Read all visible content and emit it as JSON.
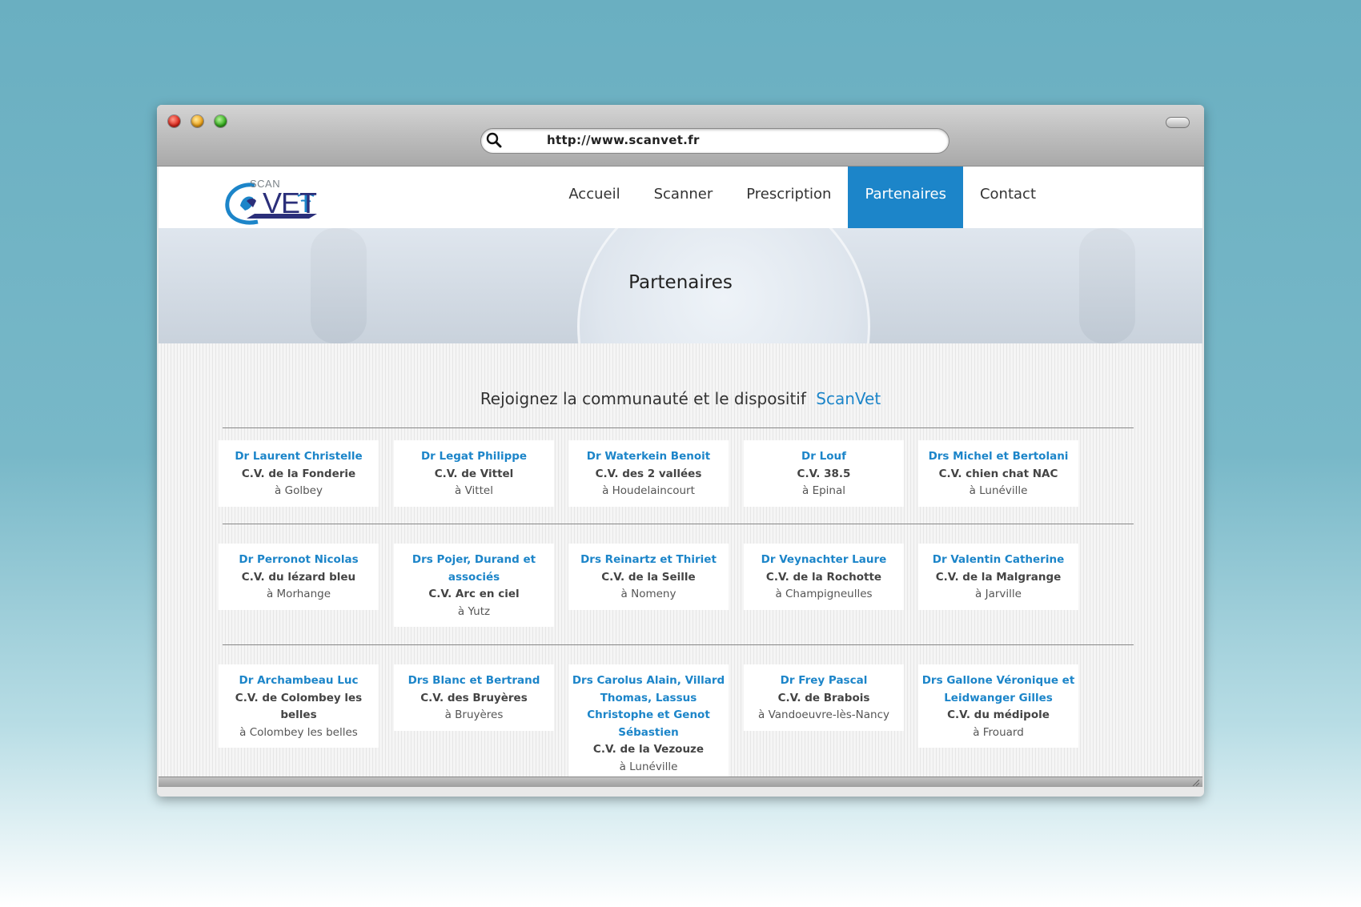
{
  "browser": {
    "url": "http://www.scanvet.fr"
  },
  "site": {
    "logo": {
      "scan": "SCAN",
      "vet": "VET"
    },
    "nav": [
      "Accueil",
      "Scanner",
      "Prescription",
      "Partenaires",
      "Contact"
    ],
    "active_nav": "Partenaires",
    "banner_title": "Partenaires",
    "subtitle": "Rejoignez la communauté et le dispositif",
    "subtitle_brand": "ScanVet",
    "accent_color": "#1c85c9"
  },
  "partners": [
    [
      {
        "name": "Dr Laurent Christelle",
        "clinic": "C.V. de la Fonderie",
        "city": "à Golbey"
      },
      {
        "name": "Dr Legat Philippe",
        "clinic": "C.V. de Vittel",
        "city": "à Vittel"
      },
      {
        "name": "Dr Waterkein Benoit",
        "clinic": "C.V. des 2 vallées",
        "city": "à Houdelaincourt"
      },
      {
        "name": "Dr Louf",
        "clinic": "C.V. 38.5",
        "city": "à Epinal"
      },
      {
        "name": "Drs Michel et Bertolani",
        "clinic": "C.V. chien chat NAC",
        "city": "à Lunéville"
      }
    ],
    [
      {
        "name": "Dr Perronot Nicolas",
        "clinic": "C.V. du lézard bleu",
        "city": "à Morhange"
      },
      {
        "name": "Drs Pojer, Durand et associés",
        "clinic": "C.V. Arc en ciel",
        "city": "à Yutz"
      },
      {
        "name": "Drs Reinartz et Thiriet",
        "clinic": "C.V. de la Seille",
        "city": "à Nomeny"
      },
      {
        "name": "Dr Veynachter Laure",
        "clinic": "C.V. de la Rochotte",
        "city": "à Champigneulles"
      },
      {
        "name": "Dr Valentin Catherine",
        "clinic": "C.V. de la Malgrange",
        "city": "à Jarville"
      }
    ],
    [
      {
        "name": "Dr Archambeau Luc",
        "clinic": "C.V. de Colombey les belles",
        "city": "à Colombey les belles"
      },
      {
        "name": "Drs Blanc et Bertrand",
        "clinic": "C.V. des Bruyères",
        "city": "à Bruyères"
      },
      {
        "name": "Drs Carolus Alain, Villard Thomas, Lassus Christophe et Genot Sébastien",
        "clinic": "C.V. de la Vezouze",
        "city": "à Lunéville"
      },
      {
        "name": "Dr Frey Pascal",
        "clinic": "C.V. de Brabois",
        "city": "à Vandoeuvre-lès-Nancy"
      },
      {
        "name": "Drs Gallone Véronique et Leidwanger Gilles",
        "clinic": "C.V. du médipole",
        "city": "à Frouard"
      }
    ]
  ]
}
